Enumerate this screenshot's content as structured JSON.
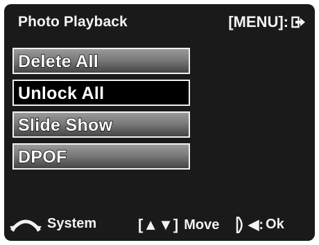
{
  "header": {
    "title": "Photo Playback",
    "menu_hint": "[MENU]:"
  },
  "menu": {
    "items": [
      {
        "label": "Delete All",
        "selected": false
      },
      {
        "label": "Unlock All",
        "selected": true
      },
      {
        "label": "Slide Show",
        "selected": false
      },
      {
        "label": "DPOF",
        "selected": false
      }
    ]
  },
  "footer": {
    "system_label": "System",
    "move_key": "[▲▼]",
    "move_label": "Move",
    "ok_key": "◀:",
    "ok_label": "Ok"
  },
  "icons": {
    "exit": "exit-arrow-icon",
    "system": "mode-dial-icon",
    "ok": "d-pad-right-icon"
  },
  "colors": {
    "background": "#1a1a1a",
    "text": "#f4f4f4",
    "item_border": "#f2f2f2",
    "selected_item": "#000000"
  }
}
